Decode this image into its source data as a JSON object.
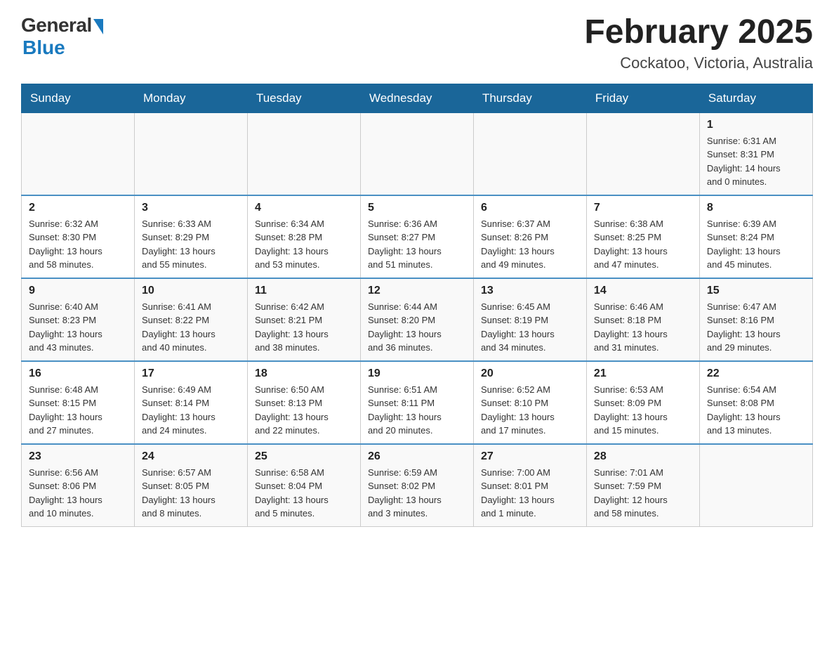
{
  "header": {
    "logo_general": "General",
    "logo_blue": "Blue",
    "title": "February 2025",
    "subtitle": "Cockatoo, Victoria, Australia"
  },
  "weekdays": [
    "Sunday",
    "Monday",
    "Tuesday",
    "Wednesday",
    "Thursday",
    "Friday",
    "Saturday"
  ],
  "weeks": [
    [
      {
        "day": "",
        "info": ""
      },
      {
        "day": "",
        "info": ""
      },
      {
        "day": "",
        "info": ""
      },
      {
        "day": "",
        "info": ""
      },
      {
        "day": "",
        "info": ""
      },
      {
        "day": "",
        "info": ""
      },
      {
        "day": "1",
        "info": "Sunrise: 6:31 AM\nSunset: 8:31 PM\nDaylight: 14 hours\nand 0 minutes."
      }
    ],
    [
      {
        "day": "2",
        "info": "Sunrise: 6:32 AM\nSunset: 8:30 PM\nDaylight: 13 hours\nand 58 minutes."
      },
      {
        "day": "3",
        "info": "Sunrise: 6:33 AM\nSunset: 8:29 PM\nDaylight: 13 hours\nand 55 minutes."
      },
      {
        "day": "4",
        "info": "Sunrise: 6:34 AM\nSunset: 8:28 PM\nDaylight: 13 hours\nand 53 minutes."
      },
      {
        "day": "5",
        "info": "Sunrise: 6:36 AM\nSunset: 8:27 PM\nDaylight: 13 hours\nand 51 minutes."
      },
      {
        "day": "6",
        "info": "Sunrise: 6:37 AM\nSunset: 8:26 PM\nDaylight: 13 hours\nand 49 minutes."
      },
      {
        "day": "7",
        "info": "Sunrise: 6:38 AM\nSunset: 8:25 PM\nDaylight: 13 hours\nand 47 minutes."
      },
      {
        "day": "8",
        "info": "Sunrise: 6:39 AM\nSunset: 8:24 PM\nDaylight: 13 hours\nand 45 minutes."
      }
    ],
    [
      {
        "day": "9",
        "info": "Sunrise: 6:40 AM\nSunset: 8:23 PM\nDaylight: 13 hours\nand 43 minutes."
      },
      {
        "day": "10",
        "info": "Sunrise: 6:41 AM\nSunset: 8:22 PM\nDaylight: 13 hours\nand 40 minutes."
      },
      {
        "day": "11",
        "info": "Sunrise: 6:42 AM\nSunset: 8:21 PM\nDaylight: 13 hours\nand 38 minutes."
      },
      {
        "day": "12",
        "info": "Sunrise: 6:44 AM\nSunset: 8:20 PM\nDaylight: 13 hours\nand 36 minutes."
      },
      {
        "day": "13",
        "info": "Sunrise: 6:45 AM\nSunset: 8:19 PM\nDaylight: 13 hours\nand 34 minutes."
      },
      {
        "day": "14",
        "info": "Sunrise: 6:46 AM\nSunset: 8:18 PM\nDaylight: 13 hours\nand 31 minutes."
      },
      {
        "day": "15",
        "info": "Sunrise: 6:47 AM\nSunset: 8:16 PM\nDaylight: 13 hours\nand 29 minutes."
      }
    ],
    [
      {
        "day": "16",
        "info": "Sunrise: 6:48 AM\nSunset: 8:15 PM\nDaylight: 13 hours\nand 27 minutes."
      },
      {
        "day": "17",
        "info": "Sunrise: 6:49 AM\nSunset: 8:14 PM\nDaylight: 13 hours\nand 24 minutes."
      },
      {
        "day": "18",
        "info": "Sunrise: 6:50 AM\nSunset: 8:13 PM\nDaylight: 13 hours\nand 22 minutes."
      },
      {
        "day": "19",
        "info": "Sunrise: 6:51 AM\nSunset: 8:11 PM\nDaylight: 13 hours\nand 20 minutes."
      },
      {
        "day": "20",
        "info": "Sunrise: 6:52 AM\nSunset: 8:10 PM\nDaylight: 13 hours\nand 17 minutes."
      },
      {
        "day": "21",
        "info": "Sunrise: 6:53 AM\nSunset: 8:09 PM\nDaylight: 13 hours\nand 15 minutes."
      },
      {
        "day": "22",
        "info": "Sunrise: 6:54 AM\nSunset: 8:08 PM\nDaylight: 13 hours\nand 13 minutes."
      }
    ],
    [
      {
        "day": "23",
        "info": "Sunrise: 6:56 AM\nSunset: 8:06 PM\nDaylight: 13 hours\nand 10 minutes."
      },
      {
        "day": "24",
        "info": "Sunrise: 6:57 AM\nSunset: 8:05 PM\nDaylight: 13 hours\nand 8 minutes."
      },
      {
        "day": "25",
        "info": "Sunrise: 6:58 AM\nSunset: 8:04 PM\nDaylight: 13 hours\nand 5 minutes."
      },
      {
        "day": "26",
        "info": "Sunrise: 6:59 AM\nSunset: 8:02 PM\nDaylight: 13 hours\nand 3 minutes."
      },
      {
        "day": "27",
        "info": "Sunrise: 7:00 AM\nSunset: 8:01 PM\nDaylight: 13 hours\nand 1 minute."
      },
      {
        "day": "28",
        "info": "Sunrise: 7:01 AM\nSunset: 7:59 PM\nDaylight: 12 hours\nand 58 minutes."
      },
      {
        "day": "",
        "info": ""
      }
    ]
  ]
}
